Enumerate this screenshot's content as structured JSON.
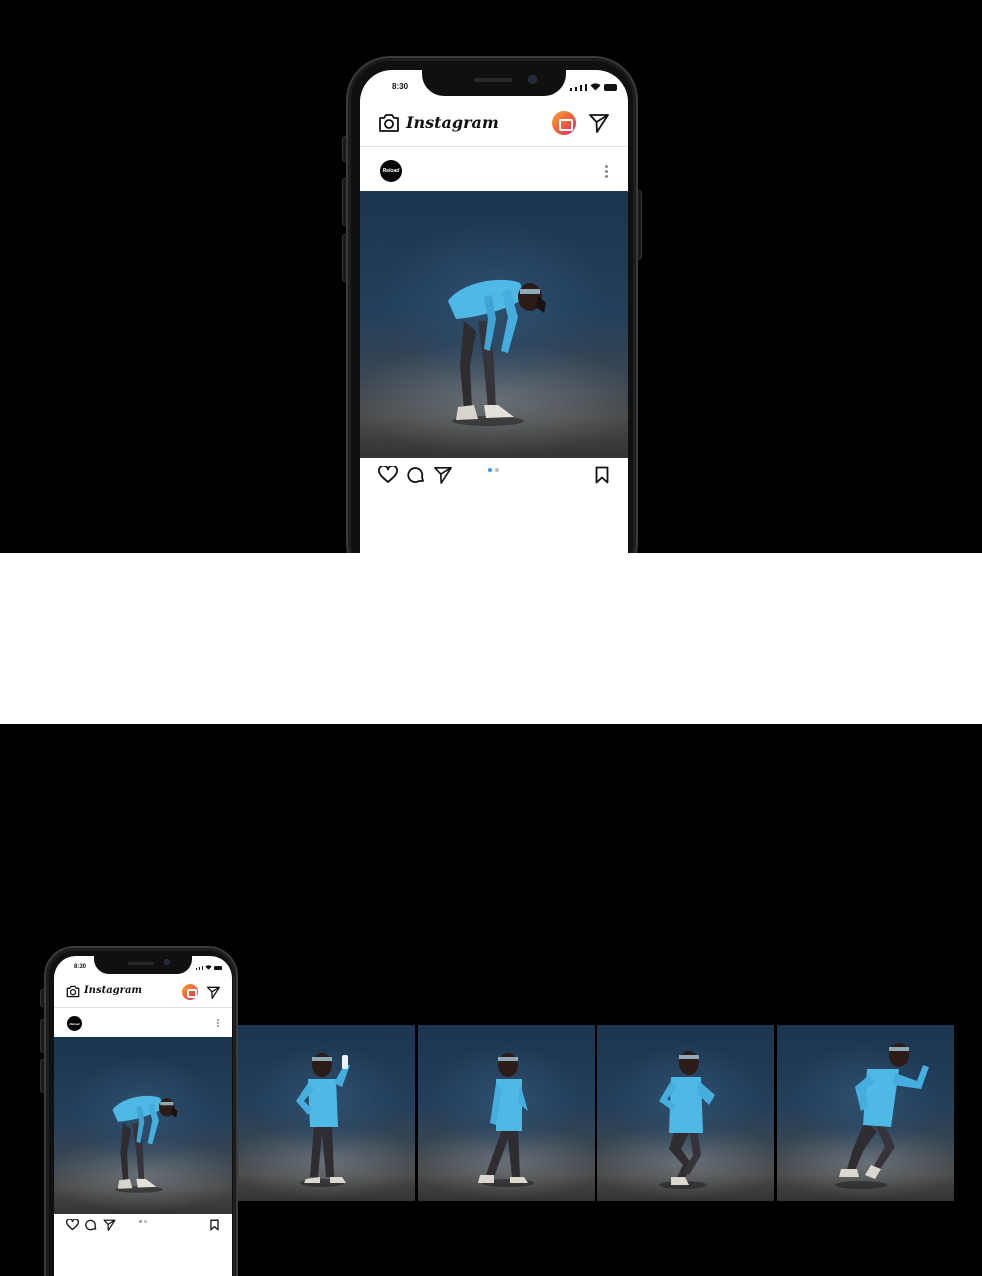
{
  "status_bar": {
    "time": "8:30"
  },
  "header": {
    "app_name": "Instagram"
  },
  "post": {
    "account_avatar_text": "Reload",
    "carousel_count": 2,
    "carousel_active_index": 0
  },
  "icons": {
    "camera": "camera-icon",
    "igtv": "igtv-icon",
    "direct": "paper-plane-icon",
    "more": "more-vertical-icon",
    "like": "heart-icon",
    "comment": "comment-icon",
    "share": "share-icon",
    "save": "bookmark-icon"
  },
  "photos": [
    "runner bending over, hands on knees",
    "runner drinking from a bottle",
    "runner walking, adjusting earbud",
    "runner jogging",
    "runner sprinting"
  ],
  "colors": {
    "background": "#000000",
    "page": "#ffffff",
    "igtv_gradient_start": "#f9a634",
    "igtv_gradient_end": "#d62976",
    "carousel_active_dot": "#3a97f0",
    "jacket_blue": "#4fb9e6"
  }
}
